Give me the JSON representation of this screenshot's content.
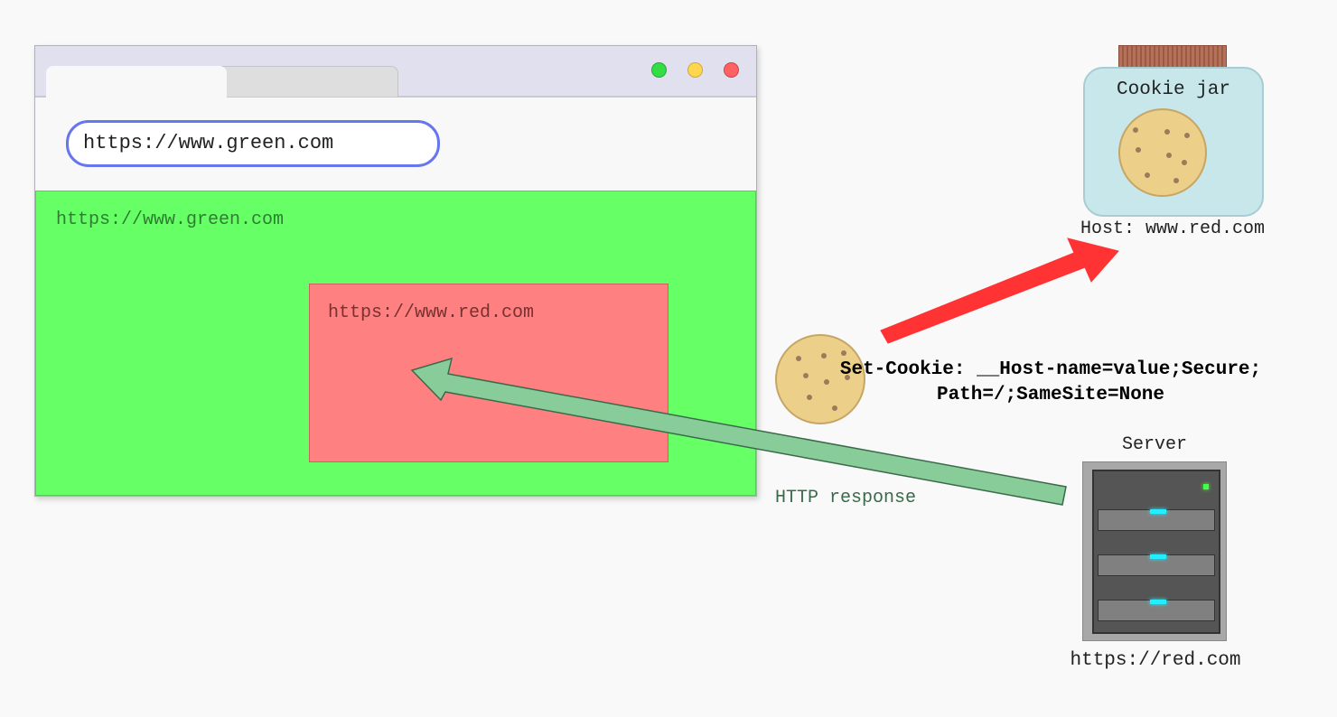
{
  "browser": {
    "address_bar": "https://www.green.com",
    "green_frame_label": "https://www.green.com",
    "red_frame_label": "https://www.red.com"
  },
  "cookie_jar": {
    "title": "Cookie jar",
    "host_label": "Host: www.red.com"
  },
  "set_cookie": {
    "line1": "Set-Cookie: __Host-name=value;Secure;",
    "line2": "Path=/;SameSite=None"
  },
  "http_response_label": "HTTP response",
  "server": {
    "title": "Server",
    "url": "https://red.com"
  },
  "colors": {
    "green_frame": "#66ff66",
    "red_frame": "#ff8080",
    "address_border": "#6677ee",
    "response_arrow": "#88cc99",
    "store_arrow": "#ff3333",
    "cookie": "#ecd08a"
  }
}
